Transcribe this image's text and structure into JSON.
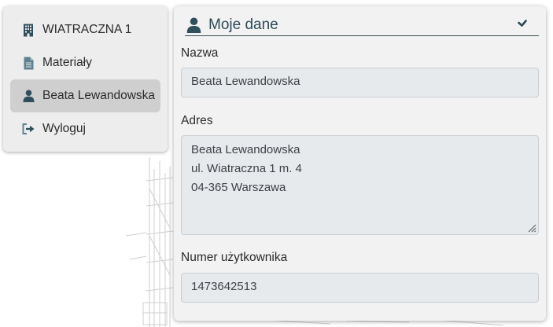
{
  "sidebar": {
    "items": [
      {
        "label": "WIATRACZNA 1",
        "icon": "building-icon",
        "active": false
      },
      {
        "label": "Materiały",
        "icon": "document-icon",
        "active": false
      },
      {
        "label": "Beata Lewandowska",
        "icon": "user-icon",
        "active": true
      },
      {
        "label": "Wyloguj",
        "icon": "logout-icon",
        "active": false
      }
    ]
  },
  "panel": {
    "title": "Moje dane",
    "title_icon": "user-icon",
    "toggle_icon": "chevron-down-icon",
    "fields": {
      "name": {
        "label": "Nazwa",
        "value": "Beata Lewandowska"
      },
      "address": {
        "label": "Adres",
        "lines": [
          "Beata Lewandowska",
          "ul. Wiatraczna 1 m. 4",
          "04-365 Warszawa"
        ]
      },
      "user_number": {
        "label": "Numer użytkownika",
        "value": "1473642513"
      }
    }
  },
  "colors": {
    "accent": "#2c4a56",
    "icon": "#2e4f5b",
    "active_item_bg": "#cfcfcf",
    "field_bg": "#e7eaed"
  }
}
